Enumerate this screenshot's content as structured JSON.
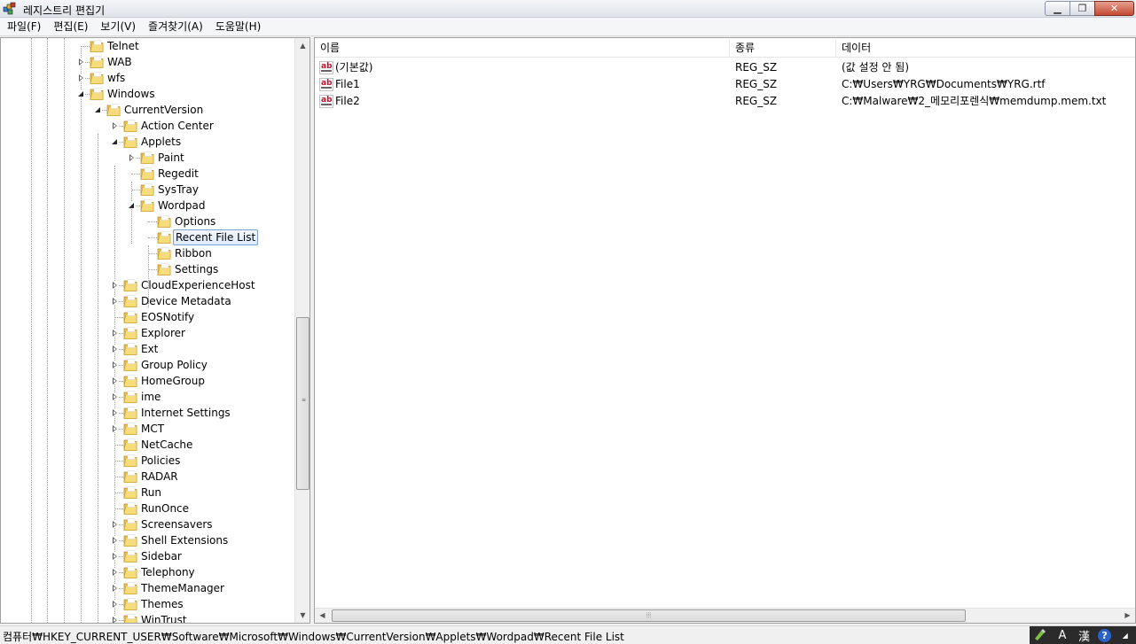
{
  "window": {
    "title": "레지스트리 편집기",
    "minimize_glyph": "▁",
    "maximize_glyph": "❐",
    "close_glyph": "✕",
    "app_icon": "regedit-icon"
  },
  "menu": {
    "items": [
      {
        "label": "파일(F)"
      },
      {
        "label": "편집(E)"
      },
      {
        "label": "보기(V)"
      },
      {
        "label": "즐겨찾기(A)"
      },
      {
        "label": "도움말(H)"
      }
    ]
  },
  "tree": {
    "nodes": [
      {
        "label": "Telnet"
      },
      {
        "label": "WAB"
      },
      {
        "label": "wfs"
      },
      {
        "label": "Windows"
      },
      {
        "label": "CurrentVersion"
      },
      {
        "label": "Action Center"
      },
      {
        "label": "Applets"
      },
      {
        "label": "Paint"
      },
      {
        "label": "Regedit"
      },
      {
        "label": "SysTray"
      },
      {
        "label": "Wordpad"
      },
      {
        "label": "Options"
      },
      {
        "label": "Recent File List",
        "selected": true
      },
      {
        "label": "Ribbon"
      },
      {
        "label": "Settings"
      },
      {
        "label": "CloudExperienceHost"
      },
      {
        "label": "Device Metadata"
      },
      {
        "label": "EOSNotify"
      },
      {
        "label": "Explorer"
      },
      {
        "label": "Ext"
      },
      {
        "label": "Group Policy"
      },
      {
        "label": "HomeGroup"
      },
      {
        "label": "ime"
      },
      {
        "label": "Internet Settings"
      },
      {
        "label": "MCT"
      },
      {
        "label": "NetCache"
      },
      {
        "label": "Policies"
      },
      {
        "label": "RADAR"
      },
      {
        "label": "Run"
      },
      {
        "label": "RunOnce"
      },
      {
        "label": "Screensavers"
      },
      {
        "label": "Shell Extensions"
      },
      {
        "label": "Sidebar"
      },
      {
        "label": "Telephony"
      },
      {
        "label": "ThemeManager"
      },
      {
        "label": "Themes"
      },
      {
        "label": "WinTrust"
      }
    ]
  },
  "list": {
    "columns": [
      {
        "label": "이름"
      },
      {
        "label": "종류"
      },
      {
        "label": "데이터"
      }
    ],
    "rows": [
      {
        "name": "(기본값)",
        "type": "REG_SZ",
        "data": "(값 설정 안 됨)"
      },
      {
        "name": "File1",
        "type": "REG_SZ",
        "data": "C:₩Users₩YRG₩Documents₩YRG.rtf"
      },
      {
        "name": "File2",
        "type": "REG_SZ",
        "data": "C:₩Malware₩2_메모리포렌식₩memdump.mem.txt"
      }
    ],
    "value_icon_text": "ab"
  },
  "status": {
    "path": "컴퓨터₩HKEY_CURRENT_USER₩Software₩Microsoft₩Windows₩CurrentVersion₩Applets₩Wordpad₩Recent File List"
  },
  "ime": {
    "mode_a": "A",
    "mode_han": "漢",
    "help": "?"
  }
}
